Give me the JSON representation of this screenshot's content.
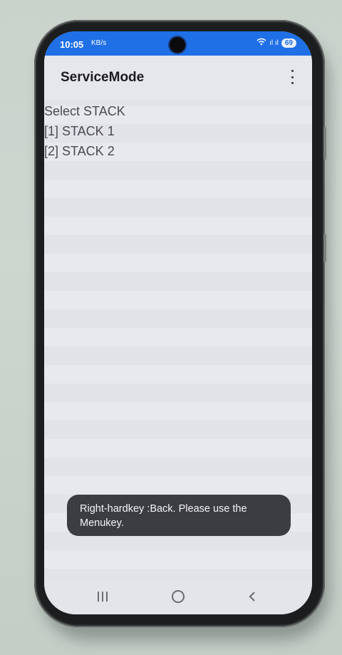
{
  "status_bar": {
    "time": "10:05",
    "small_icon": "KB/s",
    "signal_text": "ıl ıl",
    "battery": "69"
  },
  "app_bar": {
    "title": "ServiceMode",
    "menu_icon": "more-vert-icon"
  },
  "content": {
    "lines": [
      "Select STACK",
      "[1] STACK 1",
      "[2] STACK 2"
    ]
  },
  "toast": {
    "text": "Right-hardkey :Back.   Please use the Menukey."
  },
  "navigation": {
    "recent_icon": "recent-apps-icon",
    "home_icon": "home-icon",
    "back_icon": "back-icon"
  },
  "colors": {
    "status_bar": "#1f6fe6",
    "screen_bg": "#e8e8ef",
    "toast_bg": "#3c3d42"
  }
}
